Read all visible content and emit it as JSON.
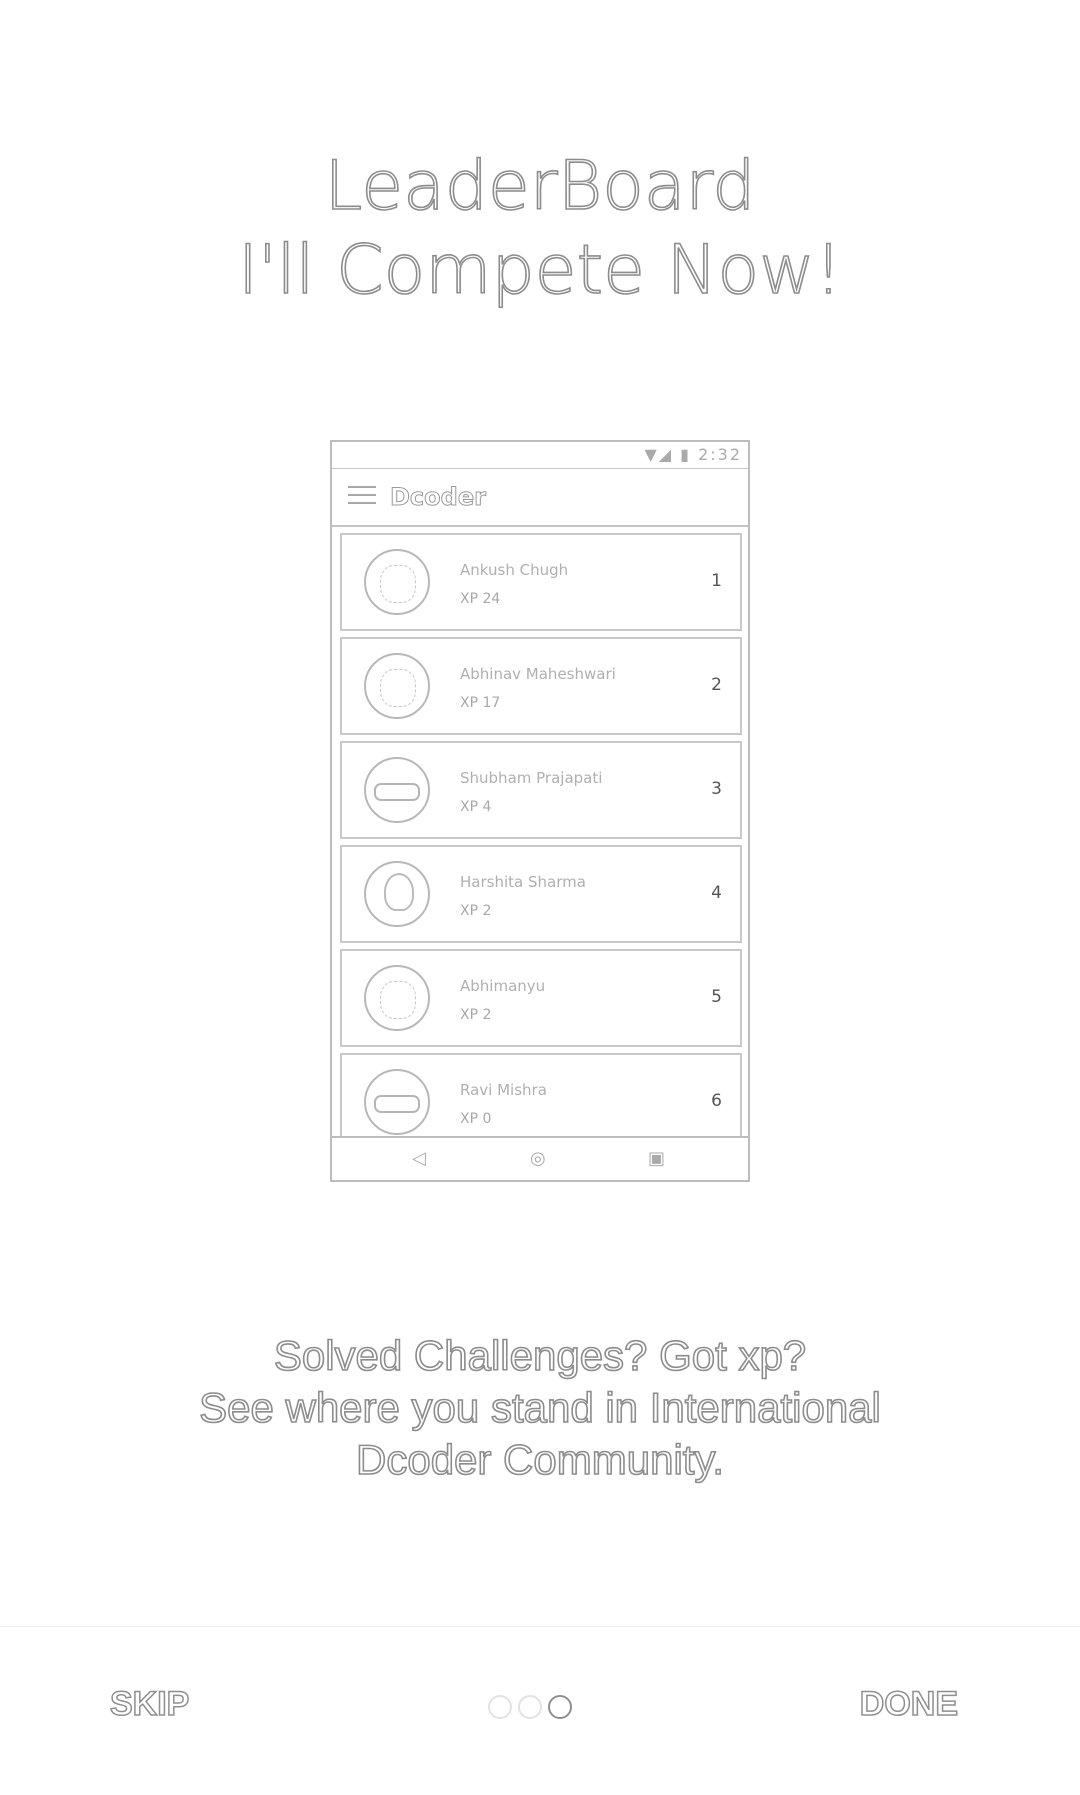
{
  "heading": {
    "line1": "LeaderBoard",
    "line2": "I'll Compete Now!"
  },
  "mockup": {
    "status_icons": "▼◢ ▮ 2:32",
    "app_title": "Dcoder",
    "entries": [
      {
        "name": "Ankush Chugh",
        "xp": "XP 24",
        "rank": "1",
        "avatar": "photo-avatar-icon"
      },
      {
        "name": "Abhinav Maheshwari",
        "xp": "XP 17",
        "rank": "2",
        "avatar": "photo-avatar-icon"
      },
      {
        "name": "Shubham Prajapati",
        "xp": "XP 4",
        "rank": "3",
        "avatar": "ninja-avatar-icon"
      },
      {
        "name": "Harshita Sharma",
        "xp": "XP 2",
        "rank": "4",
        "avatar": "person-avatar-icon"
      },
      {
        "name": "Abhimanyu",
        "xp": "XP 2",
        "rank": "5",
        "avatar": "photo-avatar-icon"
      },
      {
        "name": "Ravi Mishra",
        "xp": "XP 0",
        "rank": "6",
        "avatar": "ninja-avatar-icon"
      }
    ],
    "nav": {
      "back": "◁",
      "home": "◎",
      "recent": "▣"
    }
  },
  "description": {
    "line1": "Solved Challenges? Got xp?",
    "line2": "See where you stand in International",
    "line3": "Dcoder Community."
  },
  "footer": {
    "skip_label": "SKIP",
    "done_label": "DONE",
    "pages_total": 3,
    "current_page": 3
  }
}
